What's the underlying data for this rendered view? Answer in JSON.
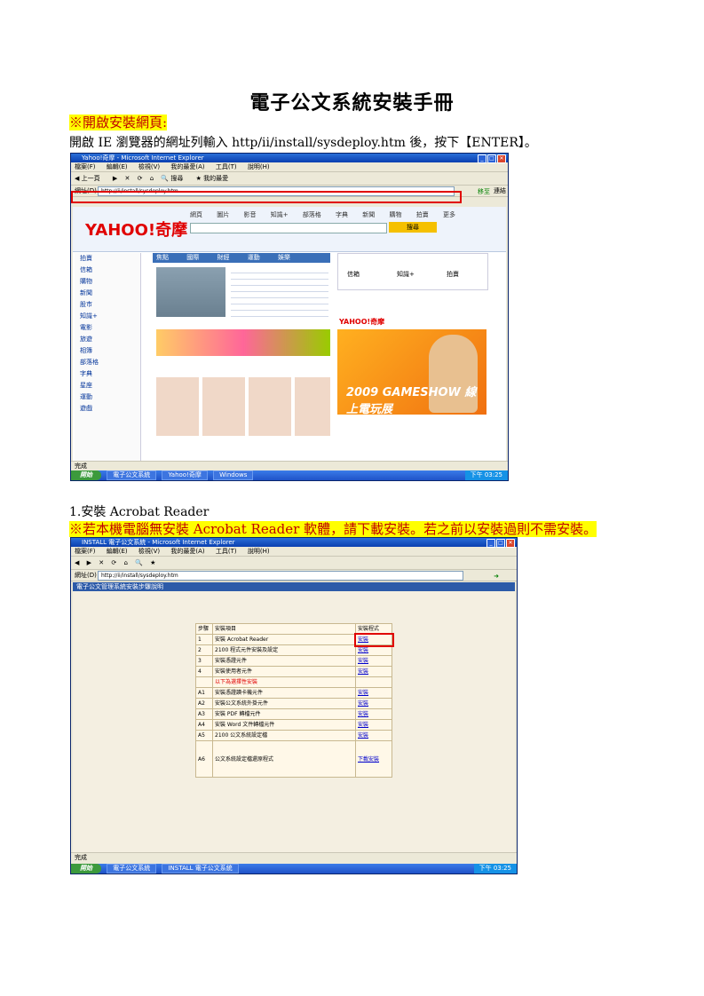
{
  "document": {
    "title": "電子公文系統安裝手冊",
    "note_open_page": "※開啟安裝網頁:",
    "step_open_page": "開啟 IE 瀏覽器的網址列輸入 http/ii/install/sysdeploy.htm 後，按下【ENTER】。",
    "section_1_heading": "1.安裝 Acrobat Reader",
    "note_acrobat": "※若本機電腦無安裝 Acrobat Reader 軟體，請下載安裝。若之前以安裝過則不需安裝。"
  },
  "screenshot1": {
    "window_title": "Yahoo!奇摩 - Microsoft Internet Explorer",
    "menu": [
      "檔案(F)",
      "編輯(E)",
      "檢視(V)",
      "我的最愛(A)",
      "工具(T)",
      "說明(H)"
    ],
    "toolbar": [
      "上一頁",
      "下一頁",
      "搜尋",
      "我的最愛"
    ],
    "address_label": "網址(D)",
    "address_value": "http://ii/install/sysdeploy.htm",
    "go_label": "移至",
    "links_label": "連結",
    "logo": "YAHOO!奇摩",
    "top_tabs": [
      "網頁",
      "圖片",
      "影音",
      "知識+",
      "部落格",
      "字典",
      "新聞",
      "購物",
      "拍賣",
      "更多"
    ],
    "search_button": "搜尋",
    "sidebar": [
      "拍賣",
      "信箱",
      "購物",
      "新聞",
      "股市",
      "知識+",
      "電影",
      "旅遊",
      "相簿",
      "部落格",
      "字典",
      "星座",
      "運動",
      "遊戲"
    ],
    "news_tabs": [
      "焦點",
      "國際",
      "財經",
      "運動",
      "娛樂"
    ],
    "mail_items": [
      "信箱",
      "知識+",
      "拍賣"
    ],
    "ad_text": "2009 GAMESHOW 線上電玩展",
    "ad_logo": "YAHOO!奇摩",
    "status_text": "完成",
    "taskbar_start": "開始",
    "taskbar_tasks": [
      "電子公文系統",
      "Yahoo!奇摩",
      "Windows"
    ],
    "clock": "下午 03:25"
  },
  "screenshot2": {
    "window_title": "INSTALL 電子公文系統 - Microsoft Internet Explorer",
    "menu": [
      "檔案(F)",
      "編輯(E)",
      "檢視(V)",
      "我的最愛(A)",
      "工具(T)",
      "說明(H)"
    ],
    "address_label": "網址(D)",
    "address_value": "http://ii/install/sysdeploy.htm",
    "page_heading": "電子公文管理系統安裝步驟說明",
    "table_header": [
      "步驟",
      "安裝項目",
      "安裝程式"
    ],
    "rows": [
      {
        "step": "1",
        "item": "安裝 Acrobat Reader",
        "action": "安裝"
      },
      {
        "step": "2",
        "item": "2100 程式元件安裝及設定",
        "action": "安裝"
      },
      {
        "step": "3",
        "item": "安裝憑證元件",
        "action": "安裝"
      },
      {
        "step": "4",
        "item": "安裝使用者元件",
        "action": "安裝"
      },
      {
        "step": "",
        "item": "以下為選擇性安裝",
        "action": ""
      },
      {
        "step": "A1",
        "item": "安裝憑證讀卡機元件",
        "action": "安裝"
      },
      {
        "step": "A2",
        "item": "安裝公文系統外掛元件",
        "action": "安裝"
      },
      {
        "step": "A3",
        "item": "安裝 PDF 轉檔元件",
        "action": "安裝"
      },
      {
        "step": "A4",
        "item": "安裝 Word 文件轉檔元件",
        "action": "安裝"
      },
      {
        "step": "A5",
        "item": "2100 公文系統設定檔",
        "action": "安裝"
      },
      {
        "step": "A6",
        "item": "公文系統設定檔還原程式",
        "action": "下載安裝"
      }
    ],
    "status_text": "完成",
    "taskbar_start": "開始",
    "taskbar_tasks": [
      "電子公文系統",
      "INSTALL 電子公文系統"
    ],
    "clock": "下午 03:25"
  }
}
